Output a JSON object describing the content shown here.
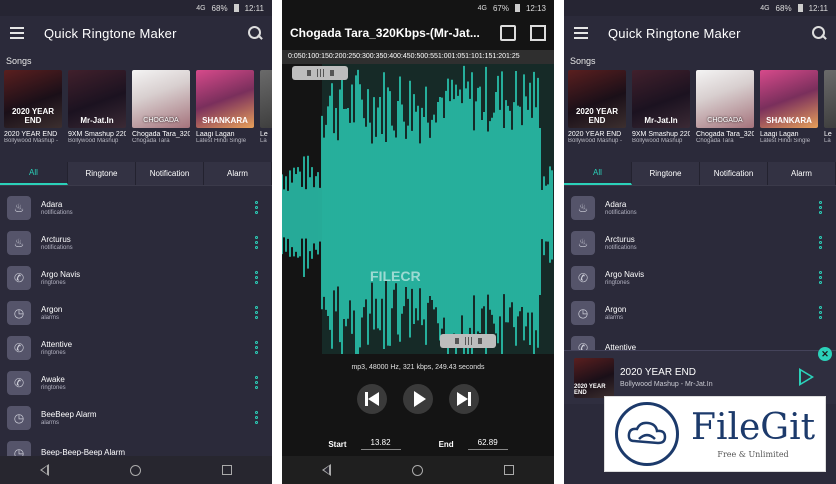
{
  "status_left": {
    "network": "4G",
    "battery": "68%",
    "time": "12:11"
  },
  "status_mid": {
    "network": "4G",
    "battery": "67%",
    "time": "12:13"
  },
  "status_right": {
    "network": "4G",
    "battery": "68%",
    "time": "12:11"
  },
  "app": {
    "title": "Quick Ringtone Maker"
  },
  "songs": {
    "section_title": "Songs",
    "items": [
      {
        "art_text": "2020 YEAR END",
        "name": "2020 YEAR END",
        "sub": "Bollywood Mashup -"
      },
      {
        "art_text": "Mr-Jat.In",
        "name": "9XM Smashup 220_3",
        "sub": "Bollywood Mashup"
      },
      {
        "art_text": "CHOGADA",
        "name": "Chogada Tara_320Kb",
        "sub": "Chogada Tara"
      },
      {
        "art_text": "SHANKARA",
        "name": "Laagi Lagan",
        "sub": "Latest Hindi Single"
      },
      {
        "art_text": "",
        "name": "Le",
        "sub": "La"
      }
    ]
  },
  "tabs": [
    "All",
    "Ringtone",
    "Notification",
    "Alarm"
  ],
  "ringtones": [
    {
      "name": "Adara",
      "category": "notifications",
      "icon": "bell-icon"
    },
    {
      "name": "Arcturus",
      "category": "notifications",
      "icon": "bell-icon"
    },
    {
      "name": "Argo Navis",
      "category": "ringtones",
      "icon": "phone-icon"
    },
    {
      "name": "Argon",
      "category": "alarms",
      "icon": "clock-icon"
    },
    {
      "name": "Attentive",
      "category": "ringtones",
      "icon": "phone-icon"
    },
    {
      "name": "Awake",
      "category": "ringtones",
      "icon": "phone-icon"
    },
    {
      "name": "BeeBeep Alarm",
      "category": "alarms",
      "icon": "clock-icon"
    },
    {
      "name": "Beep-Beep-Beep Alarm",
      "category": "",
      "icon": "clock-icon"
    }
  ],
  "editor": {
    "title": "Chogada Tara_320Kbps-(Mr-Jat...",
    "ruler": "0:050:100:150:200:250:300:350:400:450:500:551:001:051:101:151:201:25",
    "watermark": "FILECR",
    "audio_info": "mp3, 48000 Hz, 321 kbps, 249.43 seconds",
    "start_label": "Start",
    "start_value": "13.82",
    "end_label": "End",
    "end_value": "62.89",
    "wave_color": "#2bd1b9"
  },
  "mini_player": {
    "art_text": "2020 YEAR END",
    "title": "2020 YEAR END",
    "subtitle": "Bollywood Mashup - Mr-Jat.In"
  },
  "watermark": {
    "name": "FileGit",
    "tagline": "Free & Unlimited"
  },
  "colors": {
    "accent": "#2bd1b9",
    "bg": "#2b2a3a",
    "brand_blue": "#1c3a6b"
  }
}
